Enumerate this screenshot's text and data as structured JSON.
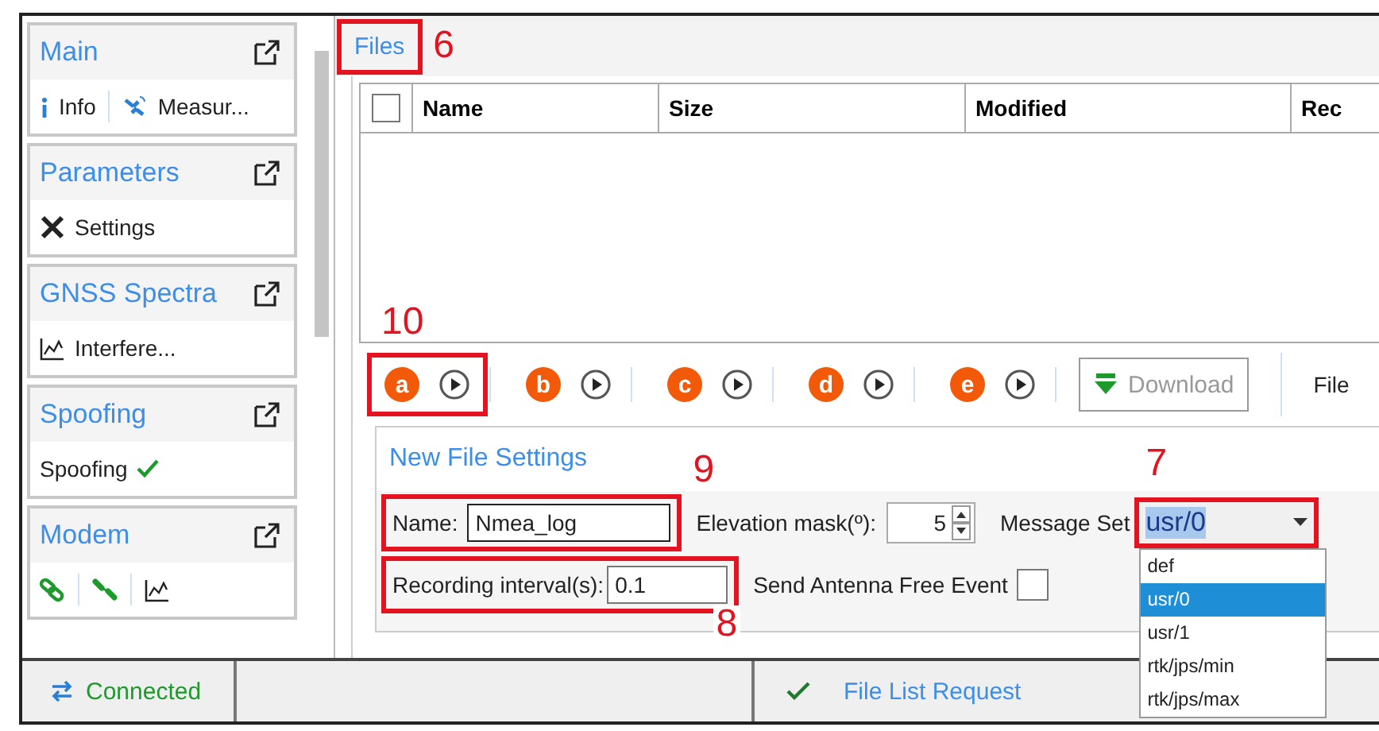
{
  "sidebar": {
    "sections": [
      {
        "title": "Main",
        "items": [
          {
            "kind": "info",
            "label": "Info"
          },
          {
            "kind": "satellite",
            "label": "Measur..."
          }
        ]
      },
      {
        "title": "Parameters",
        "items": [
          {
            "kind": "tools",
            "label": "Settings"
          }
        ]
      },
      {
        "title": "GNSS Spectra",
        "items": [
          {
            "kind": "chart",
            "label": "Interfere..."
          }
        ]
      },
      {
        "title": "Spoofing",
        "items": [
          {
            "kind": "status",
            "label": "Spoofing",
            "checked": true
          }
        ]
      },
      {
        "title": "Modem",
        "items": [
          {
            "kind": "link"
          },
          {
            "kind": "unlink"
          },
          {
            "kind": "chart"
          }
        ]
      }
    ]
  },
  "files_panel": {
    "title": "Files",
    "callout": "6",
    "table": {
      "select_all_checked": false,
      "columns": [
        "Name",
        "Size",
        "Modified",
        "Rec"
      ]
    },
    "toolbar": {
      "channels": [
        {
          "letter": "a",
          "callout": "10"
        },
        {
          "letter": "b"
        },
        {
          "letter": "c"
        },
        {
          "letter": "d"
        },
        {
          "letter": "e"
        }
      ],
      "download": {
        "label": "Download",
        "disabled": true
      },
      "files_label": "File"
    },
    "new_file_settings": {
      "title": "New File Settings",
      "name": {
        "label": "Name:",
        "value": "Nmea_log",
        "callout": "9"
      },
      "elevation_mask": {
        "label": "Elevation mask(º):",
        "value": "5"
      },
      "message_set": {
        "label": "Message Set",
        "value": "usr/0",
        "callout": "7",
        "expanded": true,
        "options": [
          {
            "label": "def",
            "selected": false
          },
          {
            "label": "usr/0",
            "selected": true
          },
          {
            "label": "usr/1",
            "selected": false
          },
          {
            "label": "rtk/jps/min",
            "selected": false
          },
          {
            "label": "rtk/jps/max",
            "selected": false
          }
        ]
      },
      "recording_interval": {
        "label": "Recording interval(s):",
        "value": "0.1",
        "callout": "8"
      },
      "send_antenna_free_event": {
        "label": "Send Antenna Free Event",
        "checked": false
      }
    }
  },
  "status_bar": {
    "connection": "Connected",
    "request": "File List Request"
  }
}
